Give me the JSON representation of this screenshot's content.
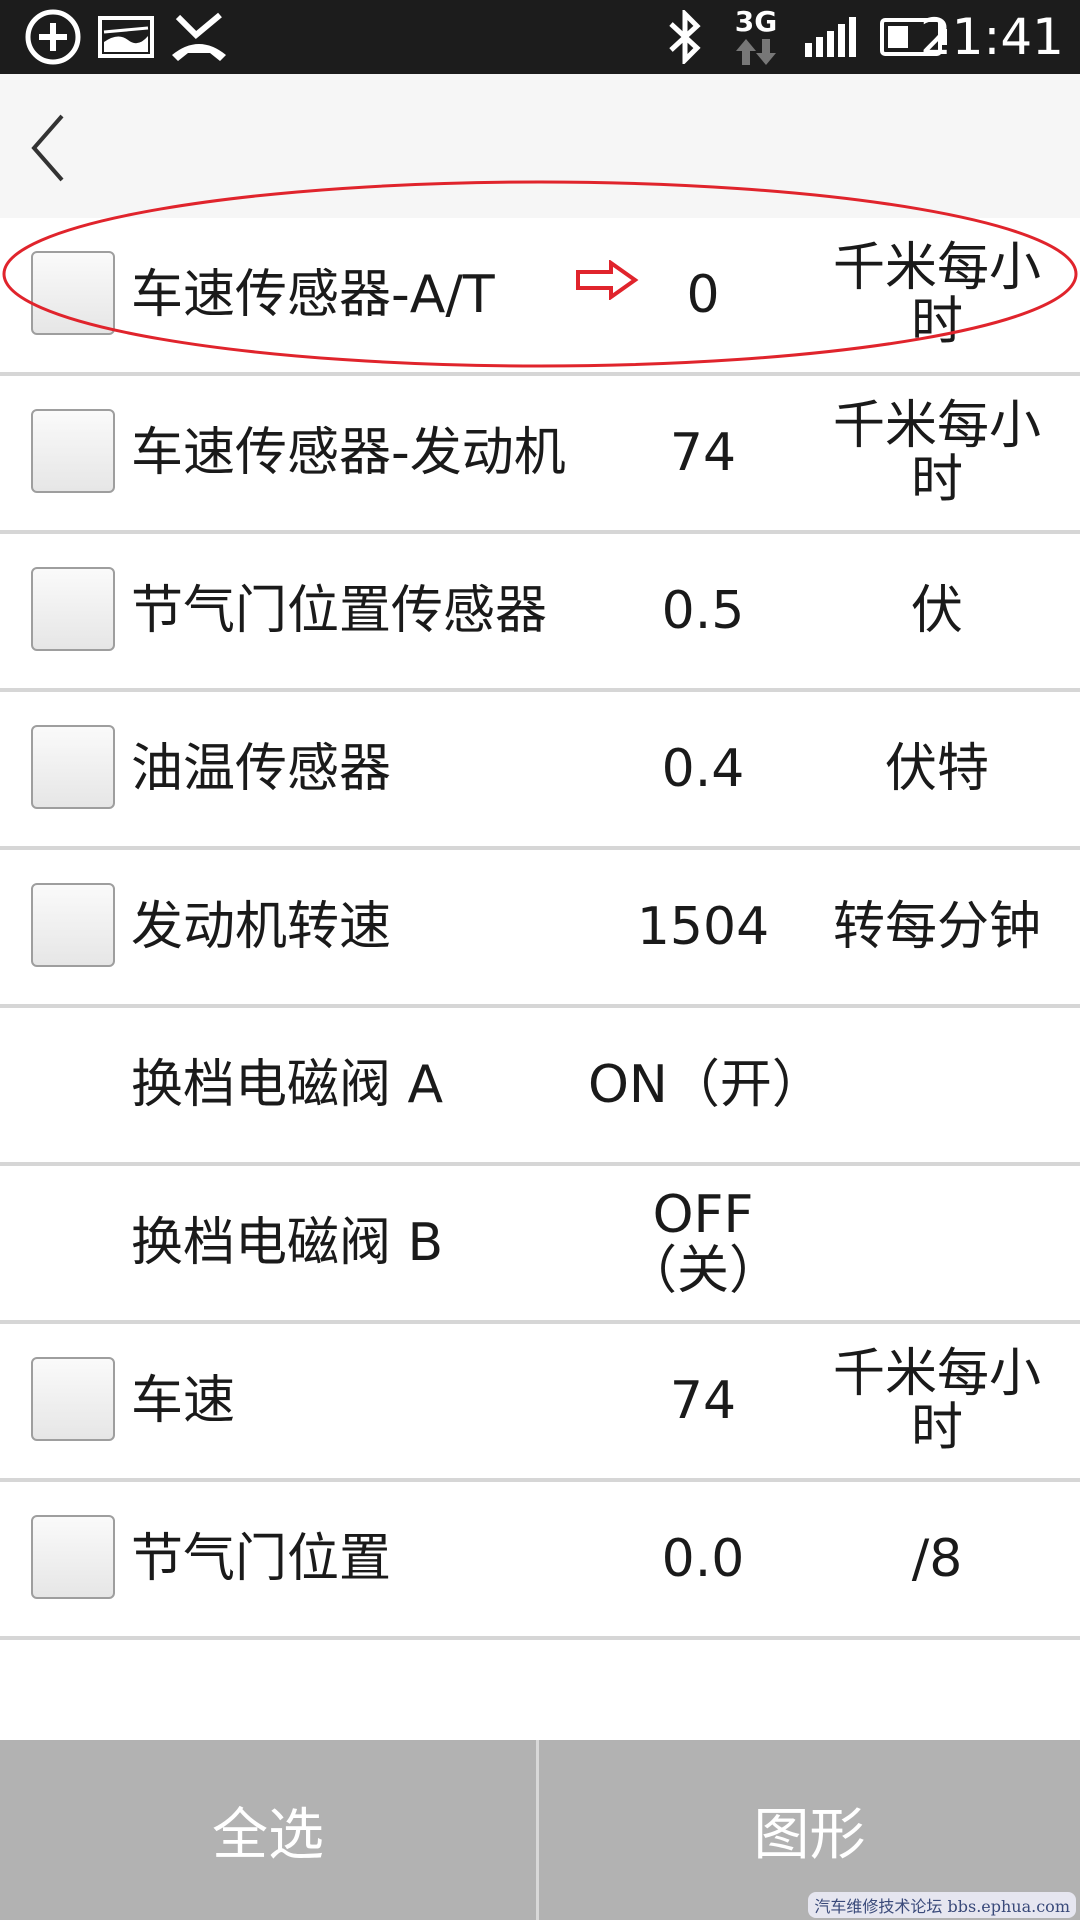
{
  "status_bar": {
    "time": "21:41",
    "network_type": "3G",
    "icons": [
      "add-circle-icon",
      "image-icon",
      "missed-call-icon",
      "bluetooth-icon",
      "data-arrows-icon",
      "signal-icon",
      "battery-icon"
    ]
  },
  "header": {
    "back_icon": "chevron-left-icon"
  },
  "rows": [
    {
      "name": "车速传感器-A/T",
      "value": "0",
      "unit": "千米每小时",
      "has_checkbox": true,
      "highlighted": true
    },
    {
      "name": "车速传感器-发动机",
      "value": "74",
      "unit": "千米每小时",
      "has_checkbox": true
    },
    {
      "name": "节气门位置传感器",
      "value": "0.5",
      "unit": "伏",
      "has_checkbox": true
    },
    {
      "name": "油温传感器",
      "value": "0.4",
      "unit": "伏特",
      "has_checkbox": true
    },
    {
      "name": "发动机转速",
      "value": "1504",
      "unit": "转每分钟",
      "has_checkbox": true
    },
    {
      "name": "换档电磁阀 A",
      "value": "ON（开）",
      "unit": "",
      "has_checkbox": false
    },
    {
      "name": "换档电磁阀 B",
      "value": "OFF（关）",
      "unit": "",
      "has_checkbox": false
    },
    {
      "name": "车速",
      "value": "74",
      "unit": "千米每小时",
      "has_checkbox": true
    },
    {
      "name": "节气门位置",
      "value": "0.0",
      "unit": "/8",
      "has_checkbox": true
    }
  ],
  "annotation": {
    "color": "#e0242c"
  },
  "bottom_bar": {
    "select_all_label": "全选",
    "graph_label": "图形"
  },
  "watermark": "汽车维修技术论坛 bbs.ephua.com"
}
